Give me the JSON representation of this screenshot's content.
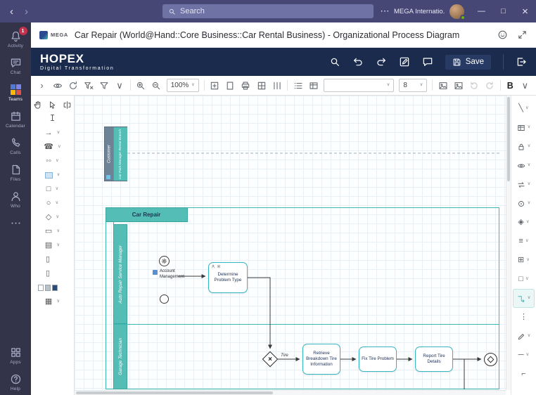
{
  "colors": {
    "titlebar": "#464775",
    "rail": "#33344a",
    "header": "#1b2b4d",
    "accent": "#3cb8b2",
    "lane_fill": "#54bdb6",
    "task_border": "#35b7c0",
    "badge": "#c4314b"
  },
  "titlebar": {
    "search_placeholder": "Search",
    "account_label": "MEGA Internatio..."
  },
  "rail": {
    "items": [
      {
        "label": "Activity",
        "icon": "bell",
        "badge": "1"
      },
      {
        "label": "Chat",
        "icon": "chat"
      },
      {
        "label": "Teams",
        "icon": "teams-logo",
        "active": true
      },
      {
        "label": "Calendar",
        "icon": "calendar"
      },
      {
        "label": "Calls",
        "icon": "phone-handset"
      },
      {
        "label": "Files",
        "icon": "file"
      },
      {
        "label": "Who",
        "icon": "person"
      },
      {
        "label": "",
        "icon": "dots-h"
      }
    ],
    "bottom": [
      {
        "label": "Apps",
        "icon": "apps"
      },
      {
        "label": "Help",
        "icon": "help"
      }
    ]
  },
  "app_header": {
    "logo_text": "MEGA",
    "title": "Car Repair (World@Hand::Core Business::Car Rental Business) - Organizational Process Diagram"
  },
  "hopex": {
    "brand": "HOPEX",
    "subtitle": "Digital Transformation",
    "save_label": "Save"
  },
  "toolbar": {
    "zoom_value": "100%",
    "shape_value": "",
    "font_size": "8",
    "bold_label": "B",
    "icons_a": [
      "chevron-right",
      "eye",
      "refresh",
      "funnel-x",
      "funnel",
      "chevron-down"
    ],
    "icons_b": [
      "zoom-in",
      "zoom-out"
    ],
    "icons_c": [
      "page-fit",
      "page",
      "print",
      "grid",
      "columns"
    ],
    "icons_d": [
      "list",
      "table"
    ],
    "icons_e": [
      "image",
      "image",
      "rotate-ccw",
      "rotate-cw"
    ],
    "icons_f": [
      "chevron-down"
    ]
  },
  "left_palette": {
    "top_tools": [
      "hand",
      "cursor",
      "compare"
    ],
    "second": [
      "ibeam"
    ],
    "rows": [
      {
        "icon": "arrow-right",
        "chevron": true
      },
      {
        "icon": "phone",
        "chevron": true
      },
      {
        "icon": "ellipses",
        "chevron": true
      },
      {
        "icon": "square-blue",
        "chevron": true
      },
      {
        "icon": "square",
        "chevron": true
      },
      {
        "icon": "circle",
        "chevron": true
      },
      {
        "icon": "diamond",
        "chevron": true
      },
      {
        "icon": "rect-wide",
        "chevron": true
      },
      {
        "icon": "hatch-square",
        "chevron": true
      },
      {
        "icon": "doc",
        "chevron": false
      },
      {
        "icon": "doc",
        "chevron": false
      },
      {
        "icon": "pages",
        "chevron": false
      },
      {
        "icon": "grid-square",
        "chevron": true
      }
    ]
  },
  "right_palette": {
    "rows": [
      {
        "icon": "diag",
        "chevron": true
      },
      {
        "icon": "table",
        "chevron": true
      },
      {
        "icon": "lock",
        "chevron": true
      },
      {
        "icon": "eye",
        "chevron": true
      },
      {
        "icon": "swap",
        "chevron": true
      },
      {
        "icon": "target",
        "chevron": true
      },
      {
        "icon": "shapes",
        "chevron": true
      },
      {
        "icon": "bars",
        "chevron": true
      },
      {
        "icon": "plus-box",
        "chevron": true
      },
      {
        "icon": "square",
        "chevron": true
      },
      {
        "icon": "elbow",
        "chevron": true,
        "active": true
      },
      {
        "icon": "dots-v",
        "chevron": false
      },
      {
        "icon": "pencil",
        "chevron": true
      },
      {
        "icon": "line",
        "chevron": true
      },
      {
        "icon": "corner",
        "chevron": false
      }
    ]
  },
  "diagram": {
    "customer_pool": {
      "outer_label": "Customer",
      "inner_label": "Car Park Manager Rental Branch"
    },
    "pool_title": "Car Repair",
    "lanes": [
      {
        "label": "Auto Repair Service Manager"
      },
      {
        "label": "Garage Technician"
      }
    ],
    "account_label": "Account Management",
    "flow_label": "Tire",
    "tasks": [
      {
        "label": "Determine Problem Type"
      },
      {
        "label": "Retrieve Breakdown Tire Information"
      },
      {
        "label": "Fix Tire Problem"
      },
      {
        "label": "Report Tire Details"
      }
    ]
  }
}
